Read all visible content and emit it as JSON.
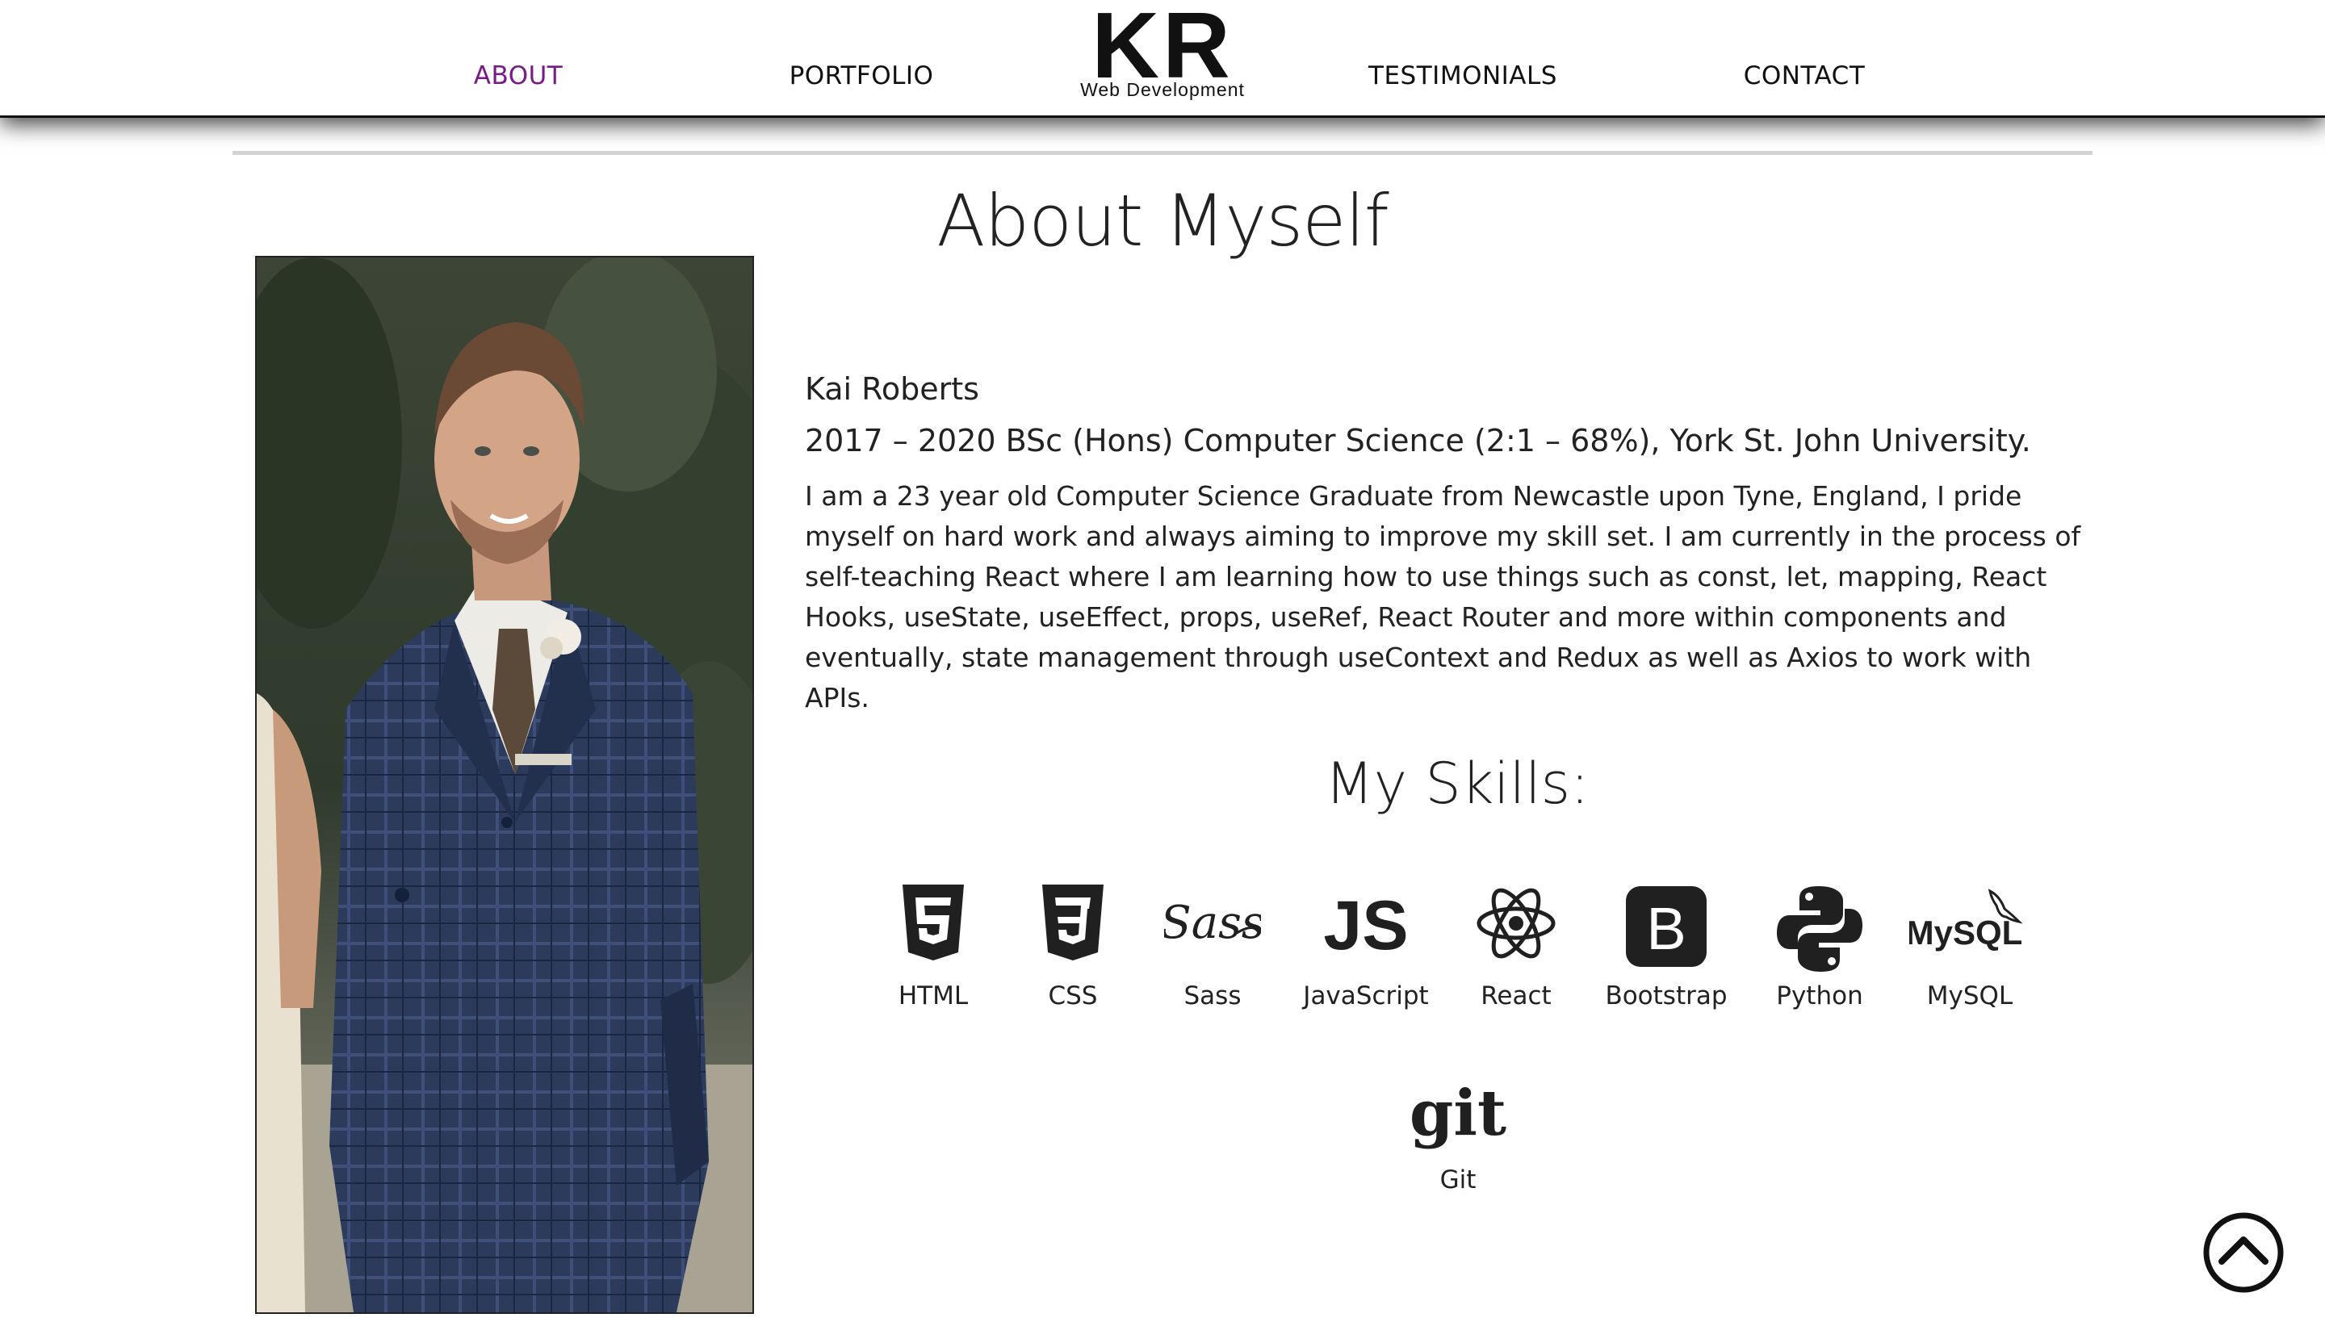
{
  "nav": {
    "items": [
      {
        "label": "ABOUT",
        "active": true
      },
      {
        "label": "PORTFOLIO",
        "active": false
      },
      {
        "label": "TESTIMONIALS",
        "active": false
      },
      {
        "label": "CONTACT",
        "active": false
      }
    ],
    "active_color": "#7a1a8a"
  },
  "logo": {
    "mark": "KR",
    "tagline": "Web Development"
  },
  "about": {
    "title": "About Myself",
    "name": "Kai Roberts",
    "degree": "2017 – 2020 BSc (Hons) Computer Science (2:1 – 68%), York St. John University.",
    "bio": "I am a 23 year old Computer Science Graduate from Newcastle upon Tyne, England, I pride myself on hard work and always aiming to improve my skill set. I am currently in the process of self-teaching React where I am learning how to use things such as const, let, mapping, React Hooks, useState, useEffect, props, useRef, React Router and more within components and eventually, state management through useContext and Redux as well as Axios to work with APIs."
  },
  "photo": {
    "icon": "profile-photo"
  },
  "skills": {
    "title": "My Skills:",
    "items": [
      {
        "label": "HTML",
        "icon": "html5-icon"
      },
      {
        "label": "CSS",
        "icon": "css3-icon"
      },
      {
        "label": "Sass",
        "icon": "sass-icon"
      },
      {
        "label": "JavaScript",
        "icon": "javascript-icon"
      },
      {
        "label": "React",
        "icon": "react-icon"
      },
      {
        "label": "Bootstrap",
        "icon": "bootstrap-icon"
      },
      {
        "label": "Python",
        "icon": "python-icon"
      },
      {
        "label": "MySQL",
        "icon": "mysql-icon"
      },
      {
        "label": "Git",
        "icon": "git-icon"
      }
    ],
    "icon_glyphs": {
      "js": "JS",
      "bootstrap": "B",
      "mysql": "MySQL",
      "git": "git",
      "sass": "Sass"
    }
  },
  "scroll_top": {
    "icon": "chevron-up-circle-icon"
  }
}
